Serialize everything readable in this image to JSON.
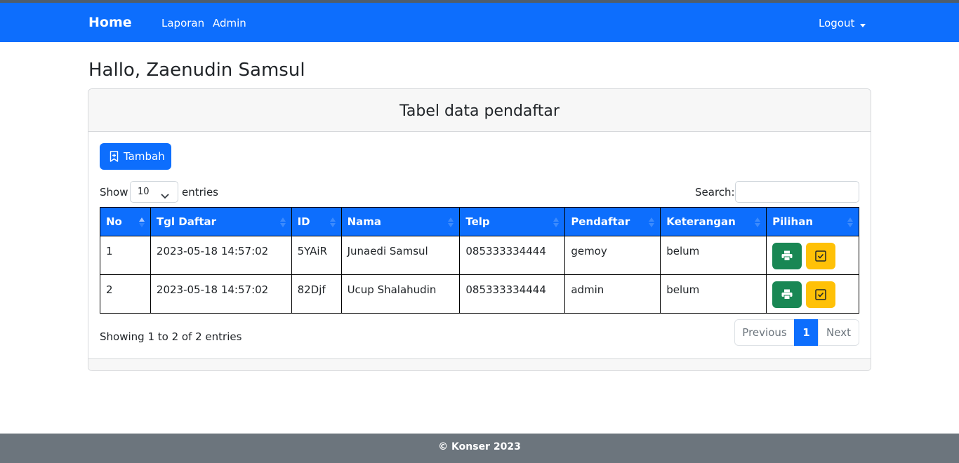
{
  "nav": {
    "brand": "Home",
    "links": [
      "Laporan",
      "Admin"
    ],
    "logout": "Logout"
  },
  "greeting": "Hallo, Zaenudin Samsul",
  "card": {
    "title": "Tabel data pendaftar",
    "add_button": "Tambah"
  },
  "length": {
    "show_label": "Show",
    "value": "10",
    "entries_label": "entries"
  },
  "search": {
    "label": "Search:",
    "value": ""
  },
  "table": {
    "columns": [
      "No",
      "Tgl Daftar",
      "ID",
      "Nama",
      "Telp",
      "Pendaftar",
      "Keterangan",
      "Pilihan"
    ],
    "rows": [
      [
        "1",
        "2023-05-18 14:57:02",
        "5YAiR",
        "Junaedi Samsul",
        "085333334444",
        "gemoy",
        "belum"
      ],
      [
        "2",
        "2023-05-18 14:57:02",
        "82Djf",
        "Ucup Shalahudin",
        "085333334444",
        "admin",
        "belum"
      ]
    ],
    "sorted_column": "No"
  },
  "info": "Showing 1 to 2 of 2 entries",
  "pagination": {
    "previous": "Previous",
    "current": "1",
    "next": "Next"
  },
  "footer": "© Konser 2023",
  "icons": {
    "add": "bookmark-plus-icon",
    "length_dropdown": "chevron-down-icon",
    "print": "printer-icon",
    "check": "check-square-icon",
    "dropdown": "caret-down-icon"
  },
  "colors": {
    "primary": "#0d6efd",
    "success": "#198754",
    "warning": "#ffc107",
    "footer": "#6c757d"
  }
}
